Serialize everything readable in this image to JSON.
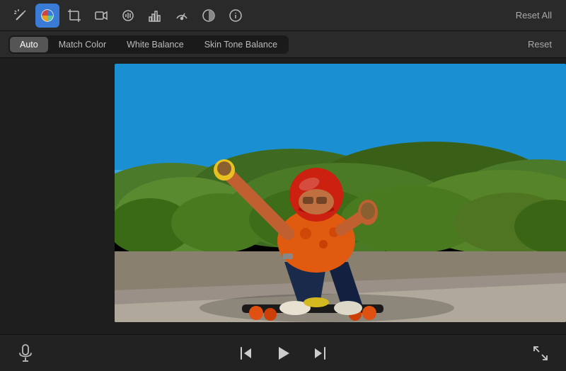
{
  "toolbar": {
    "reset_all_label": "Reset All",
    "icons": [
      {
        "name": "magic-wand-icon",
        "symbol": "✦",
        "active": false
      },
      {
        "name": "color-wheel-icon",
        "symbol": "◉",
        "active": true
      },
      {
        "name": "crop-icon",
        "symbol": "⊡",
        "active": false
      },
      {
        "name": "camera-icon",
        "symbol": "⬛",
        "active": false
      },
      {
        "name": "audio-icon",
        "symbol": "◈",
        "active": false
      },
      {
        "name": "chart-icon",
        "symbol": "▦",
        "active": false
      },
      {
        "name": "speedometer-icon",
        "symbol": "◎",
        "active": false
      },
      {
        "name": "filter-icon",
        "symbol": "◑",
        "active": false
      },
      {
        "name": "info-icon",
        "symbol": "ⓘ",
        "active": false
      }
    ]
  },
  "tabs": {
    "items": [
      {
        "id": "auto",
        "label": "Auto",
        "active": true
      },
      {
        "id": "match-color",
        "label": "Match Color",
        "active": false
      },
      {
        "id": "white-balance",
        "label": "White Balance",
        "active": false
      },
      {
        "id": "skin-tone-balance",
        "label": "Skin Tone Balance",
        "active": false
      }
    ],
    "reset_label": "Reset"
  },
  "controls": {
    "mic_label": "Microphone",
    "rewind_label": "Skip to Start",
    "play_label": "Play",
    "forward_label": "Skip to End",
    "fullscreen_label": "Fullscreen"
  }
}
